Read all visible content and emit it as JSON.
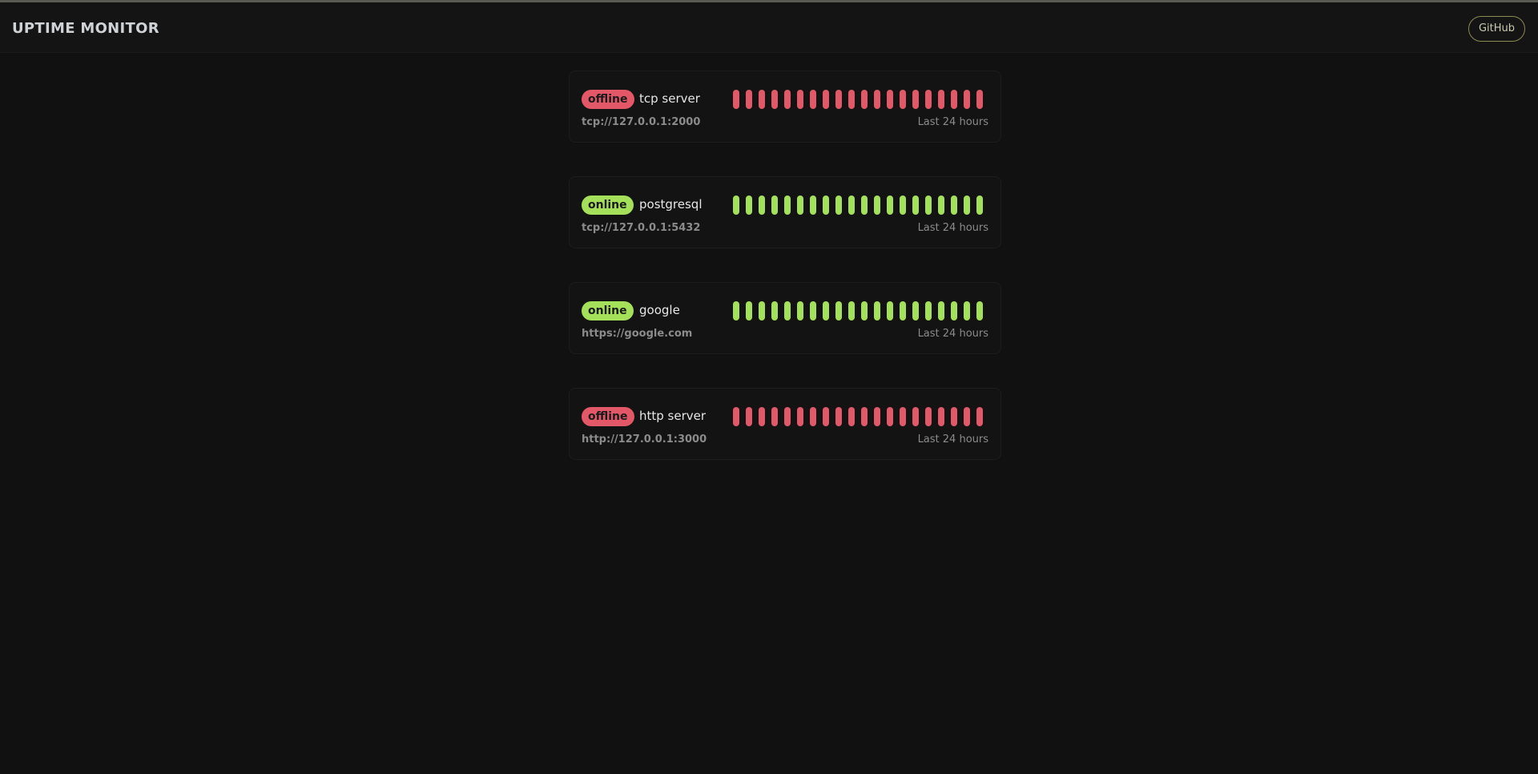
{
  "header": {
    "title": "UPTIME MONITOR",
    "github_label": "GitHub"
  },
  "colors": {
    "offline": "#e25868",
    "online": "#a5e05a",
    "background": "#111111"
  },
  "monitors": [
    {
      "status": "offline",
      "name": "tcp server",
      "url": "tcp://127.0.0.1:2000",
      "period": "Last 24 hours",
      "history": [
        "down",
        "down",
        "down",
        "down",
        "down",
        "down",
        "down",
        "down",
        "down",
        "down",
        "down",
        "down",
        "down",
        "down",
        "down",
        "down",
        "down",
        "down",
        "down",
        "down"
      ]
    },
    {
      "status": "online",
      "name": "postgresql",
      "url": "tcp://127.0.0.1:5432",
      "period": "Last 24 hours",
      "history": [
        "up",
        "up",
        "up",
        "up",
        "up",
        "up",
        "up",
        "up",
        "up",
        "up",
        "up",
        "up",
        "up",
        "up",
        "up",
        "up",
        "up",
        "up",
        "up",
        "up"
      ]
    },
    {
      "status": "online",
      "name": "google",
      "url": "https://google.com",
      "period": "Last 24 hours",
      "history": [
        "up",
        "up",
        "up",
        "up",
        "up",
        "up",
        "up",
        "up",
        "up",
        "up",
        "up",
        "up",
        "up",
        "up",
        "up",
        "up",
        "up",
        "up",
        "up",
        "up"
      ]
    },
    {
      "status": "offline",
      "name": "http server",
      "url": "http://127.0.0.1:3000",
      "period": "Last 24 hours",
      "history": [
        "down",
        "down",
        "down",
        "down",
        "down",
        "down",
        "down",
        "down",
        "down",
        "down",
        "down",
        "down",
        "down",
        "down",
        "down",
        "down",
        "down",
        "down",
        "down",
        "down"
      ]
    }
  ]
}
